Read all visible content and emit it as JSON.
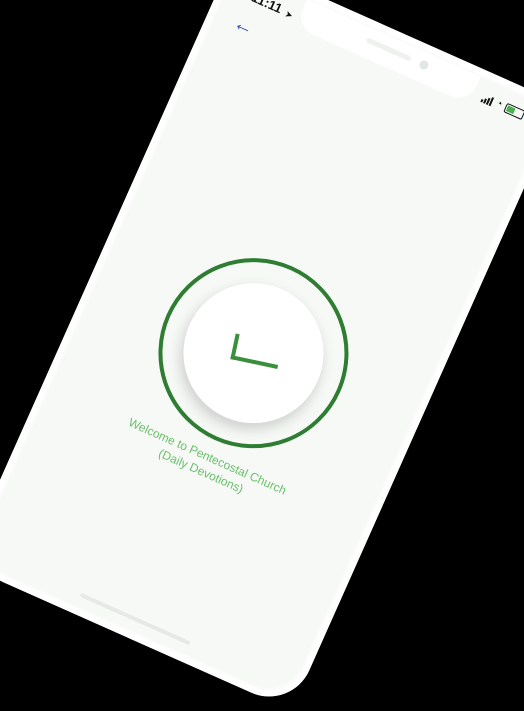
{
  "status_bar": {
    "time": "11:11",
    "location_arrow": "➤",
    "wifi_glyph": "◔"
  },
  "header": {
    "back_icon": "←"
  },
  "success": {
    "icon": "checkmark-icon",
    "ring_color": "#2e7d32",
    "check_color": "#3a8f3c"
  },
  "welcome": {
    "line1": "Welcome to Pentecostal Church",
    "line2": "(Daily Devotions)",
    "color": "#6bbf6b"
  }
}
